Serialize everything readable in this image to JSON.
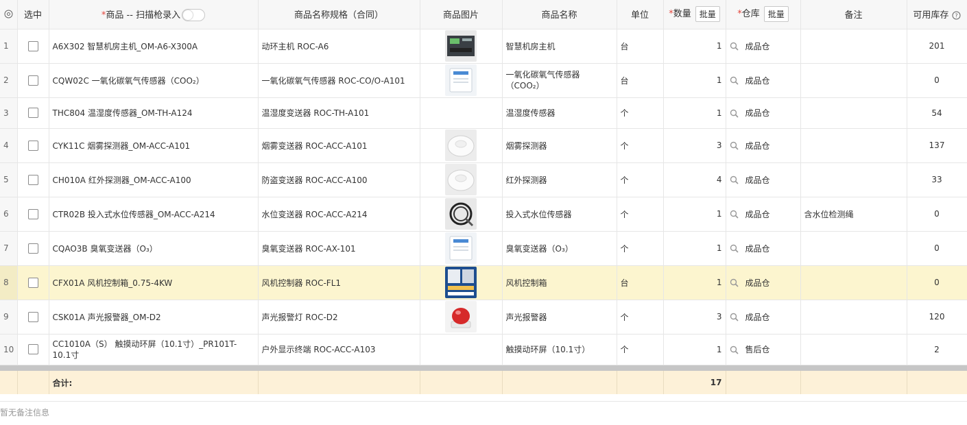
{
  "header": {
    "select": "选中",
    "product_required": "*",
    "product": "商品 -- 扫描枪录入",
    "spec": "商品名称规格（合同）",
    "image": "商品图片",
    "name": "商品名称",
    "unit": "单位",
    "qty_required": "*",
    "qty": "数量",
    "batch_label": "批量",
    "wh_required": "*",
    "warehouse": "仓库",
    "remark": "备注",
    "stock": "可用库存"
  },
  "rows": [
    {
      "idx": "1",
      "product": "A6X302 智慧机房主机_OM-A6-X300A",
      "spec": "动环主机 ROC-A6",
      "has_img": true,
      "img": "box-dark",
      "name": "智慧机房主机",
      "unit": "台",
      "qty": "1",
      "warehouse": "成品仓",
      "remark": "",
      "stock": "201"
    },
    {
      "idx": "2",
      "product": "CQW02C 一氧化碳氧气传感器（COO₂）",
      "spec": "一氧化碳氧气传感器 ROC-CO/O-A101",
      "has_img": true,
      "img": "box-white",
      "name": "一氧化碳氧气传感器（COO₂）",
      "unit": "台",
      "qty": "1",
      "warehouse": "成品仓",
      "remark": "",
      "stock": "0"
    },
    {
      "idx": "3",
      "product": "THC804 温湿度传感器_OM-TH-A124",
      "spec": "温湿度变送器 ROC-TH-A101",
      "has_img": false,
      "img": "",
      "name": "温湿度传感器",
      "unit": "个",
      "qty": "1",
      "warehouse": "成品仓",
      "remark": "",
      "stock": "54"
    },
    {
      "idx": "4",
      "product": "CYK11C 烟雾探测器_OM-ACC-A101",
      "spec": "烟雾变送器 ROC-ACC-A101",
      "has_img": true,
      "img": "round-white",
      "name": "烟雾探测器",
      "unit": "个",
      "qty": "3",
      "warehouse": "成品仓",
      "remark": "",
      "stock": "137"
    },
    {
      "idx": "5",
      "product": "CH010A 红外探测器_OM-ACC-A100",
      "spec": "防盗变送器 ROC-ACC-A100",
      "has_img": true,
      "img": "round-white",
      "name": "红外探测器",
      "unit": "个",
      "qty": "4",
      "warehouse": "成品仓",
      "remark": "",
      "stock": "33"
    },
    {
      "idx": "6",
      "product": "CTR02B 投入式水位传感器_OM-ACC-A214",
      "spec": "水位变送器 ROC-ACC-A214",
      "has_img": true,
      "img": "cable",
      "name": "投入式水位传感器",
      "unit": "个",
      "qty": "1",
      "warehouse": "成品仓",
      "remark": "含水位检测绳",
      "stock": "0"
    },
    {
      "idx": "7",
      "product": "CQAO3B 臭氧变送器（O₃）",
      "spec": "臭氧变送器 ROC-AX-101",
      "has_img": true,
      "img": "box-white",
      "name": "臭氧变送器（O₃）",
      "unit": "个",
      "qty": "1",
      "warehouse": "成品仓",
      "remark": "",
      "stock": "0"
    },
    {
      "idx": "8",
      "product": "CFX01A 风机控制箱_0.75-4KW",
      "spec": "风机控制器 ROC-FL1",
      "has_img": true,
      "img": "panel-blue",
      "name": "风机控制箱",
      "unit": "台",
      "qty": "1",
      "warehouse": "成品仓",
      "remark": "",
      "stock": "0",
      "highlight": true
    },
    {
      "idx": "9",
      "product": "CSK01A 声光报警器_OM-D2",
      "spec": "声光报警灯 ROC-D2",
      "has_img": true,
      "img": "alarm-red",
      "name": "声光报警器",
      "unit": "个",
      "qty": "3",
      "warehouse": "成品仓",
      "remark": "",
      "stock": "120"
    },
    {
      "idx": "10",
      "product": "CC1010A（S） 触摸动环屏（10.1寸）_PR101T-10.1寸",
      "spec": "户外显示终端 ROC-ACC-A103",
      "has_img": false,
      "img": "",
      "name": "触摸动环屏（10.1寸）",
      "unit": "个",
      "qty": "1",
      "warehouse": "售后仓",
      "remark": "",
      "stock": "2"
    }
  ],
  "footer": {
    "total_label": "合计:",
    "total_qty": "17"
  },
  "note": "暂无备注信息",
  "colors": {
    "header_bg": "#f7f7f7",
    "highlight_row": "#fcf5cf",
    "total_bg": "#fdf1d8",
    "required": "#e3473d"
  }
}
